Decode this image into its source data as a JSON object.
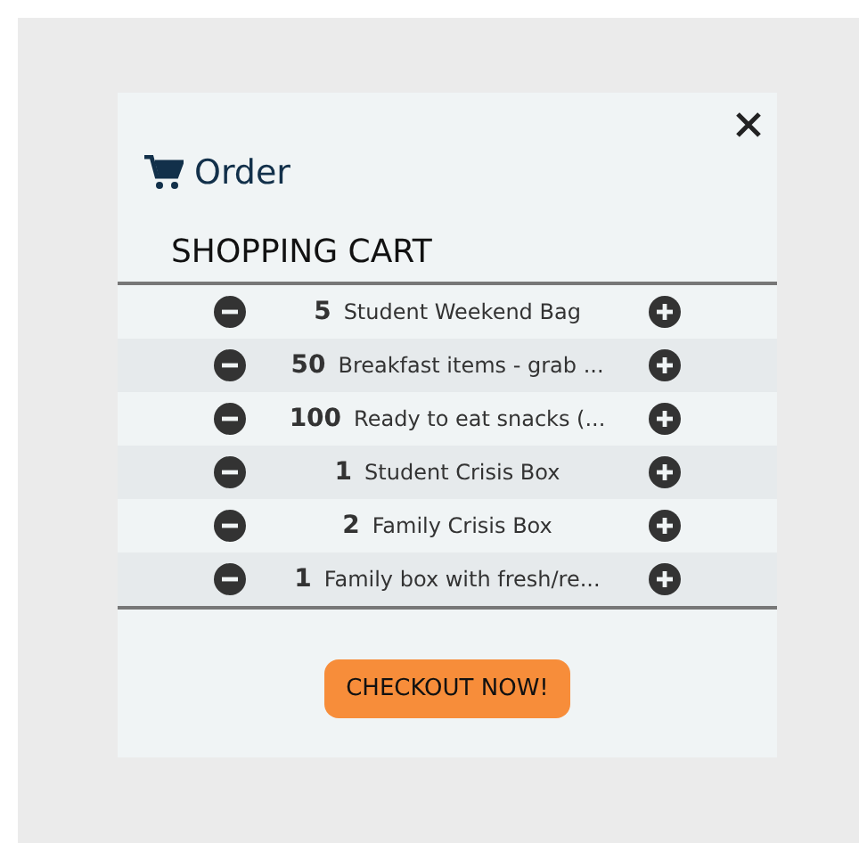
{
  "dialog": {
    "title": "Order",
    "heading": "SHOPPING CART"
  },
  "cart_items": [
    {
      "quantity": "5",
      "name": "Student Weekend Bag"
    },
    {
      "quantity": "50",
      "name": "Breakfast items - grab ..."
    },
    {
      "quantity": "100",
      "name": "Ready to eat snacks (..."
    },
    {
      "quantity": "1",
      "name": "Student Crisis Box"
    },
    {
      "quantity": "2",
      "name": "Family Crisis Box"
    },
    {
      "quantity": "1",
      "name": "Family box with fresh/re..."
    }
  ],
  "checkout_button": "CHECKOUT NOW!"
}
